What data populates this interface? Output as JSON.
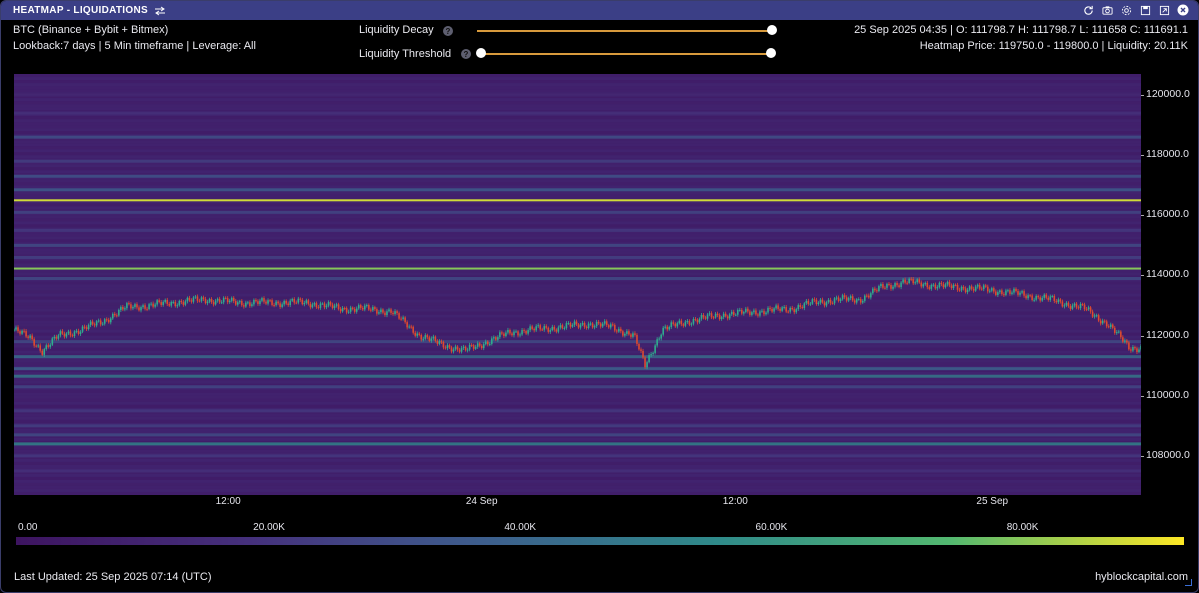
{
  "window": {
    "title": "HEATMAP - LIQUIDATIONS",
    "icons": [
      "refresh-icon",
      "camera-icon",
      "gear-icon",
      "save-icon",
      "expand-icon",
      "close-icon"
    ]
  },
  "info": {
    "pair": "BTC (Binance + Bybit + Bitmex)",
    "settings": "Lookback:7 days | 5 Min timeframe | Leverage: All",
    "ohlc": "25 Sep 2025 04:35 | O: 111798.7 H: 111798.7 L: 111658 C: 111691.1",
    "heatmap_price": "Heatmap Price: 119750.0 - 119800.0 | Liquidity: 20.11K"
  },
  "controls": {
    "decay_label": "Liquidity Decay",
    "threshold_label": "Liquidity Threshold",
    "help_glyph": "?",
    "decay_value": 1.0,
    "threshold_range": [
      0.0,
      1.0
    ]
  },
  "footer": {
    "last_updated": "Last Updated: 25 Sep 2025 07:14 (UTC)",
    "brand": "hyblockcapital.com"
  },
  "colors": {
    "titlebar": "#3b3f86",
    "background": "#40155f",
    "slider": "#d79a3c",
    "candle_up": "#2fae8e",
    "candle_down": "#e04a2e",
    "bright_level": "#fde725"
  },
  "chart_data": {
    "type": "heatmap",
    "x_ticks": [
      "12:00",
      "24 Sep",
      "12:00",
      "25 Sep"
    ],
    "x_range": [
      0,
      1
    ],
    "x_tick_positions": [
      0.19,
      0.415,
      0.64,
      0.868
    ],
    "ylim": [
      106700,
      120700
    ],
    "y_ticks": [
      "120000.0",
      "118000.0",
      "116000.0",
      "114000.0",
      "112000.0",
      "110000.0",
      "108000.0"
    ],
    "y_tick_values": [
      120000,
      118000,
      116000,
      114000,
      112000,
      110000,
      108000
    ],
    "colorbar": {
      "ticks": [
        "0.00",
        "20.00K",
        "40.00K",
        "60.00K",
        "80.00K"
      ],
      "values": [
        0,
        20000,
        40000,
        60000,
        80000
      ],
      "max": 93000
    },
    "liquidity_bands": [
      {
        "price": 120000,
        "value": 12000
      },
      {
        "price": 119400,
        "value": 18000
      },
      {
        "price": 118600,
        "value": 32000
      },
      {
        "price": 117800,
        "value": 25000
      },
      {
        "price": 117300,
        "value": 34000
      },
      {
        "price": 116850,
        "value": 38000
      },
      {
        "price": 116500,
        "value": 88000
      },
      {
        "price": 116100,
        "value": 28000
      },
      {
        "price": 115500,
        "value": 22000
      },
      {
        "price": 115000,
        "value": 30000
      },
      {
        "price": 114600,
        "value": 26000
      },
      {
        "price": 114230,
        "value": 80000
      },
      {
        "price": 113900,
        "value": 30000
      },
      {
        "price": 111800,
        "value": 30000
      },
      {
        "price": 111300,
        "value": 45000
      },
      {
        "price": 110900,
        "value": 40000
      },
      {
        "price": 110650,
        "value": 50000
      },
      {
        "price": 110300,
        "value": 28000
      },
      {
        "price": 109500,
        "value": 22000
      },
      {
        "price": 109000,
        "value": 25000
      },
      {
        "price": 108700,
        "value": 30000
      },
      {
        "price": 108400,
        "value": 55000
      },
      {
        "price": 108000,
        "value": 22000
      },
      {
        "price": 107500,
        "value": 18000
      }
    ],
    "price_series": {
      "x": [
        0.0,
        0.015,
        0.025,
        0.04,
        0.06,
        0.08,
        0.1,
        0.12,
        0.14,
        0.17,
        0.2,
        0.23,
        0.26,
        0.29,
        0.31,
        0.335,
        0.36,
        0.38,
        0.4,
        0.42,
        0.44,
        0.46,
        0.49,
        0.51,
        0.53,
        0.55,
        0.56,
        0.575,
        0.6,
        0.63,
        0.66,
        0.69,
        0.71,
        0.73,
        0.75,
        0.77,
        0.79,
        0.81,
        0.84,
        0.86,
        0.89,
        0.92,
        0.95,
        0.97,
        0.99
      ],
      "y": [
        112200,
        111900,
        111500,
        112000,
        112200,
        112500,
        112950,
        113000,
        113100,
        113200,
        113100,
        113100,
        113100,
        112900,
        112900,
        112800,
        112000,
        111700,
        111500,
        111800,
        112100,
        112200,
        112300,
        112400,
        112300,
        112000,
        111000,
        112200,
        112500,
        112700,
        112800,
        112900,
        113100,
        113200,
        113200,
        113600,
        113800,
        113700,
        113600,
        113550,
        113400,
        113200,
        112900,
        112400,
        111600
      ]
    }
  }
}
